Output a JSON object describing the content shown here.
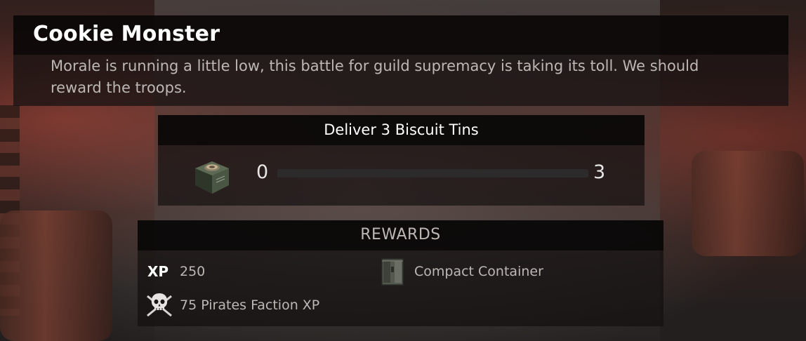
{
  "quest": {
    "title": "Cookie Monster",
    "description": "Morale is running a little low, this battle for guild supremacy is taking its toll. We should reward the troops."
  },
  "objective": {
    "label": "Deliver 3 Biscuit Tins",
    "item_icon": "biscuit-tin-icon",
    "current": "0",
    "target": "3",
    "progress_fraction": 0
  },
  "rewards": {
    "heading": "REWARDS",
    "xp_label": "XP",
    "xp_value": "250",
    "faction_icon": "pirate-skull-icon",
    "faction_xp": "75 Pirates Faction XP",
    "item_icon": "compact-container-icon",
    "item_name": "Compact Container"
  }
}
